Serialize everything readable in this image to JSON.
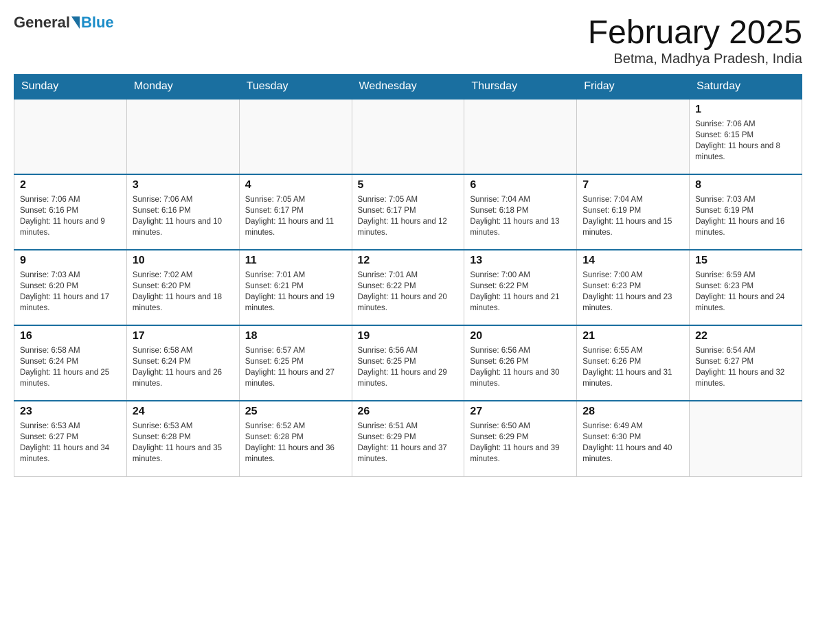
{
  "header": {
    "logo_general": "General",
    "logo_blue": "Blue",
    "month_title": "February 2025",
    "location": "Betma, Madhya Pradesh, India"
  },
  "weekdays": [
    "Sunday",
    "Monday",
    "Tuesday",
    "Wednesday",
    "Thursday",
    "Friday",
    "Saturday"
  ],
  "weeks": [
    [
      {
        "day": "",
        "info": ""
      },
      {
        "day": "",
        "info": ""
      },
      {
        "day": "",
        "info": ""
      },
      {
        "day": "",
        "info": ""
      },
      {
        "day": "",
        "info": ""
      },
      {
        "day": "",
        "info": ""
      },
      {
        "day": "1",
        "info": "Sunrise: 7:06 AM\nSunset: 6:15 PM\nDaylight: 11 hours and 8 minutes."
      }
    ],
    [
      {
        "day": "2",
        "info": "Sunrise: 7:06 AM\nSunset: 6:16 PM\nDaylight: 11 hours and 9 minutes."
      },
      {
        "day": "3",
        "info": "Sunrise: 7:06 AM\nSunset: 6:16 PM\nDaylight: 11 hours and 10 minutes."
      },
      {
        "day": "4",
        "info": "Sunrise: 7:05 AM\nSunset: 6:17 PM\nDaylight: 11 hours and 11 minutes."
      },
      {
        "day": "5",
        "info": "Sunrise: 7:05 AM\nSunset: 6:17 PM\nDaylight: 11 hours and 12 minutes."
      },
      {
        "day": "6",
        "info": "Sunrise: 7:04 AM\nSunset: 6:18 PM\nDaylight: 11 hours and 13 minutes."
      },
      {
        "day": "7",
        "info": "Sunrise: 7:04 AM\nSunset: 6:19 PM\nDaylight: 11 hours and 15 minutes."
      },
      {
        "day": "8",
        "info": "Sunrise: 7:03 AM\nSunset: 6:19 PM\nDaylight: 11 hours and 16 minutes."
      }
    ],
    [
      {
        "day": "9",
        "info": "Sunrise: 7:03 AM\nSunset: 6:20 PM\nDaylight: 11 hours and 17 minutes."
      },
      {
        "day": "10",
        "info": "Sunrise: 7:02 AM\nSunset: 6:20 PM\nDaylight: 11 hours and 18 minutes."
      },
      {
        "day": "11",
        "info": "Sunrise: 7:01 AM\nSunset: 6:21 PM\nDaylight: 11 hours and 19 minutes."
      },
      {
        "day": "12",
        "info": "Sunrise: 7:01 AM\nSunset: 6:22 PM\nDaylight: 11 hours and 20 minutes."
      },
      {
        "day": "13",
        "info": "Sunrise: 7:00 AM\nSunset: 6:22 PM\nDaylight: 11 hours and 21 minutes."
      },
      {
        "day": "14",
        "info": "Sunrise: 7:00 AM\nSunset: 6:23 PM\nDaylight: 11 hours and 23 minutes."
      },
      {
        "day": "15",
        "info": "Sunrise: 6:59 AM\nSunset: 6:23 PM\nDaylight: 11 hours and 24 minutes."
      }
    ],
    [
      {
        "day": "16",
        "info": "Sunrise: 6:58 AM\nSunset: 6:24 PM\nDaylight: 11 hours and 25 minutes."
      },
      {
        "day": "17",
        "info": "Sunrise: 6:58 AM\nSunset: 6:24 PM\nDaylight: 11 hours and 26 minutes."
      },
      {
        "day": "18",
        "info": "Sunrise: 6:57 AM\nSunset: 6:25 PM\nDaylight: 11 hours and 27 minutes."
      },
      {
        "day": "19",
        "info": "Sunrise: 6:56 AM\nSunset: 6:25 PM\nDaylight: 11 hours and 29 minutes."
      },
      {
        "day": "20",
        "info": "Sunrise: 6:56 AM\nSunset: 6:26 PM\nDaylight: 11 hours and 30 minutes."
      },
      {
        "day": "21",
        "info": "Sunrise: 6:55 AM\nSunset: 6:26 PM\nDaylight: 11 hours and 31 minutes."
      },
      {
        "day": "22",
        "info": "Sunrise: 6:54 AM\nSunset: 6:27 PM\nDaylight: 11 hours and 32 minutes."
      }
    ],
    [
      {
        "day": "23",
        "info": "Sunrise: 6:53 AM\nSunset: 6:27 PM\nDaylight: 11 hours and 34 minutes."
      },
      {
        "day": "24",
        "info": "Sunrise: 6:53 AM\nSunset: 6:28 PM\nDaylight: 11 hours and 35 minutes."
      },
      {
        "day": "25",
        "info": "Sunrise: 6:52 AM\nSunset: 6:28 PM\nDaylight: 11 hours and 36 minutes."
      },
      {
        "day": "26",
        "info": "Sunrise: 6:51 AM\nSunset: 6:29 PM\nDaylight: 11 hours and 37 minutes."
      },
      {
        "day": "27",
        "info": "Sunrise: 6:50 AM\nSunset: 6:29 PM\nDaylight: 11 hours and 39 minutes."
      },
      {
        "day": "28",
        "info": "Sunrise: 6:49 AM\nSunset: 6:30 PM\nDaylight: 11 hours and 40 minutes."
      },
      {
        "day": "",
        "info": ""
      }
    ]
  ]
}
